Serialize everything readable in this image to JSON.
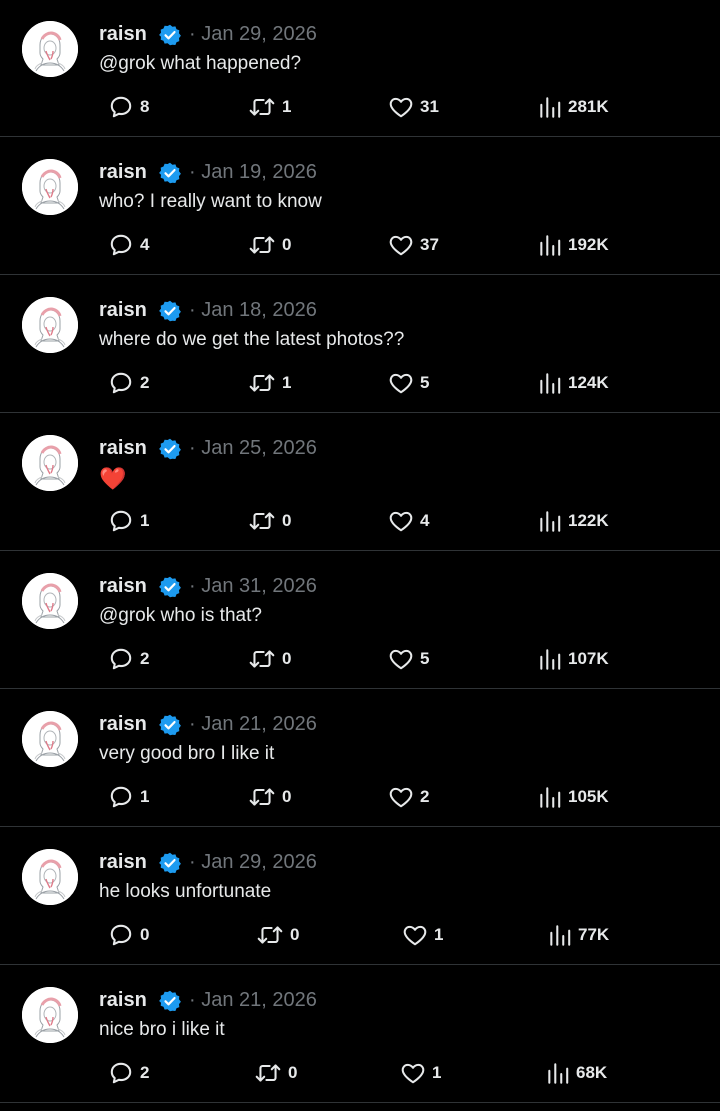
{
  "colors": {
    "background": "#000000",
    "text_primary": "#e7e9ea",
    "text_secondary": "#71767b",
    "divider": "#2f3336",
    "verified_badge": "#1d9bf0"
  },
  "icons": {
    "reply": "reply-icon",
    "retweet": "retweet-icon",
    "like": "heart-icon",
    "views": "views-icon",
    "verified": "verified-badge-icon"
  },
  "tweets": [
    {
      "name": "raisn",
      "date": "· Jan 29, 2026",
      "text": "@grok what happened?",
      "replies": "8",
      "retweets": "1",
      "likes": "31",
      "views": "281K"
    },
    {
      "name": "raisn",
      "date": "· Jan 19, 2026",
      "text": "who? I really want to know",
      "replies": "4",
      "retweets": "0",
      "likes": "37",
      "views": "192K"
    },
    {
      "name": "raisn",
      "date": "· Jan 18, 2026",
      "text": "where do we get the latest photos??",
      "replies": "2",
      "retweets": "1",
      "likes": "5",
      "views": "124K"
    },
    {
      "name": "raisn",
      "date": "· Jan 25, 2026",
      "text": "❤️",
      "replies": "1",
      "retweets": "0",
      "likes": "4",
      "views": "122K"
    },
    {
      "name": "raisn",
      "date": "· Jan 31, 2026",
      "text": "@grok who is that?",
      "replies": "2",
      "retweets": "0",
      "likes": "5",
      "views": "107K"
    },
    {
      "name": "raisn",
      "date": "· Jan 21, 2026",
      "text": "very good bro I like it",
      "replies": "1",
      "retweets": "0",
      "likes": "2",
      "views": "105K"
    },
    {
      "name": "raisn",
      "date": "· Jan 29, 2026",
      "text": "he looks unfortunate",
      "replies": "0",
      "retweets": "0",
      "likes": "1",
      "views": "77K"
    },
    {
      "name": "raisn",
      "date": "· Jan 21, 2026",
      "text": "nice bro i like it",
      "replies": "2",
      "retweets": "0",
      "likes": "1",
      "views": "68K"
    }
  ]
}
